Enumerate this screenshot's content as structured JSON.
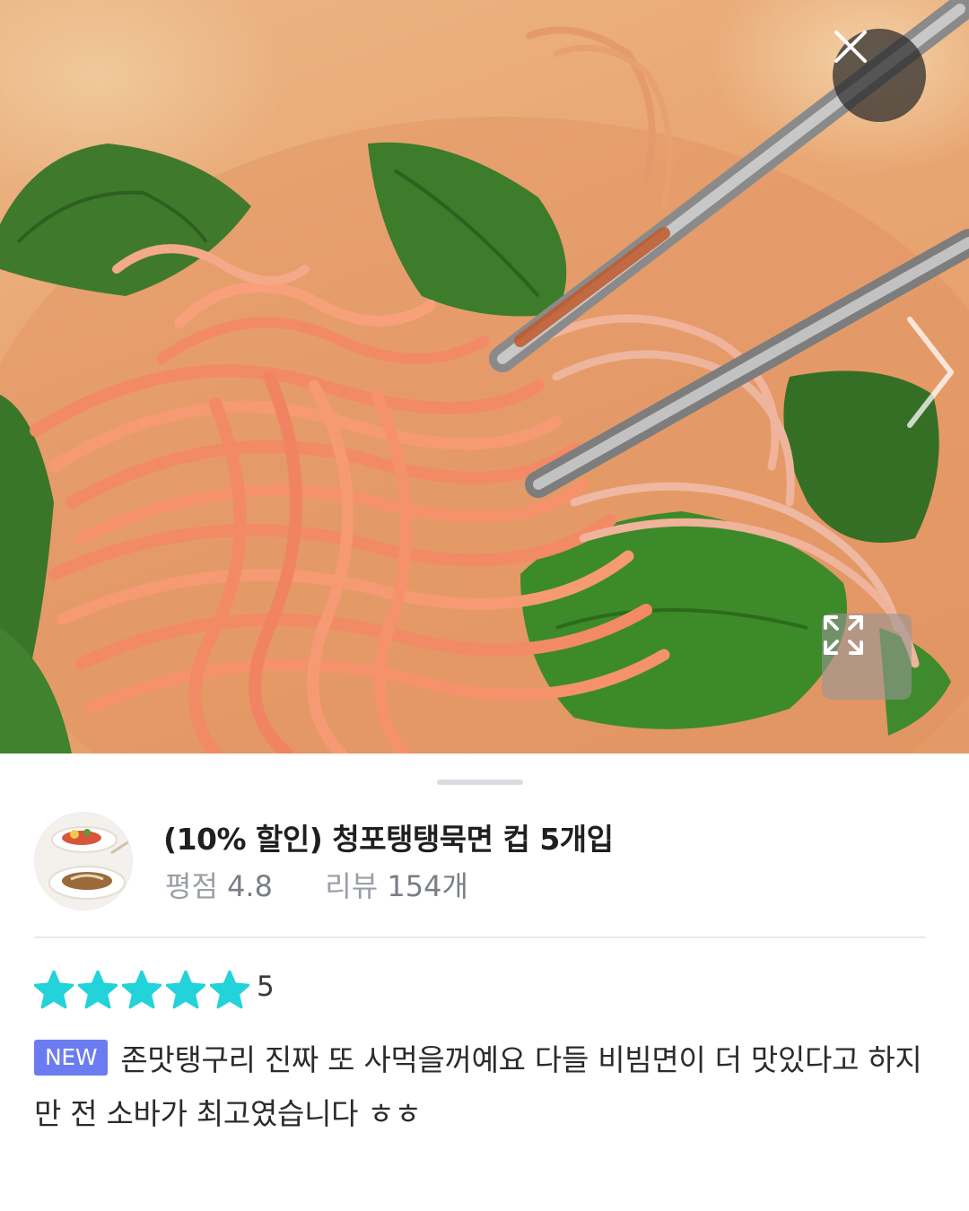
{
  "viewer": {
    "photo_label": "review-photo-noodles",
    "close_icon": "close-icon",
    "next_icon": "chevron-right-icon",
    "expand_icon": "expand-icon"
  },
  "product": {
    "title": "(10% 할인) 청포탱탱묵면 컵 5개입",
    "rating_label": "평점",
    "rating_value": "4.8",
    "review_label": "리뷰",
    "review_count": "154개"
  },
  "review": {
    "stars": 5,
    "score": "5",
    "badge": "NEW",
    "text": "존맛탱구리 진짜 또 사먹을꺼예요 다들 비빔면이 더 맛있다고 하지만 전 소바가 최고였습니다 ㅎㅎ"
  },
  "colors": {
    "star": "#22d3d9",
    "badge": "#6a7cf0",
    "close_bg": "#2c2c2c"
  }
}
